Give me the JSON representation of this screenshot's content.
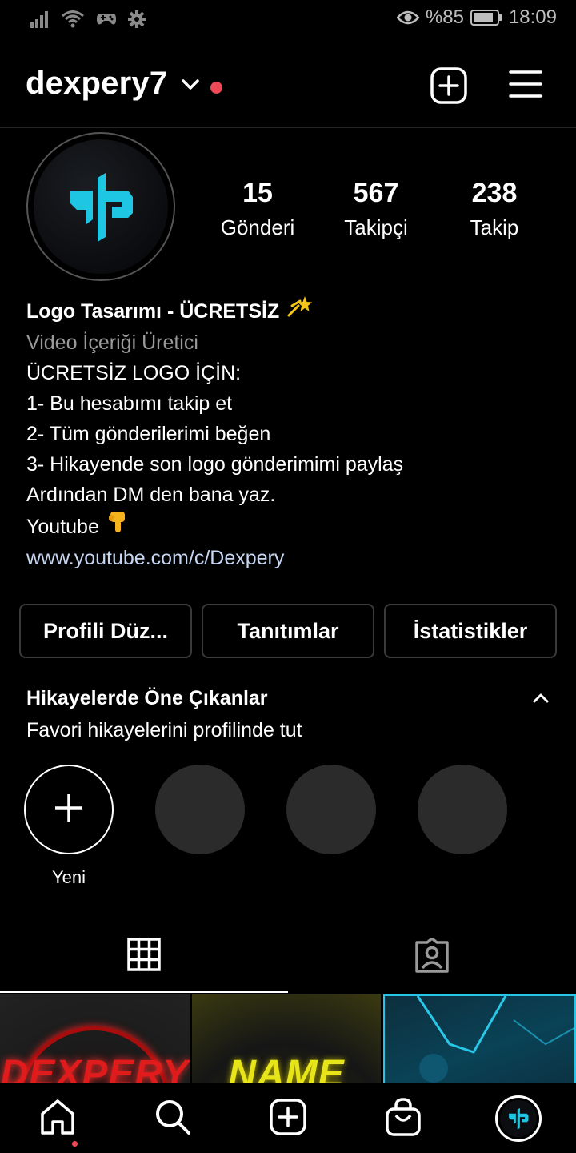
{
  "status_bar": {
    "battery": "%85",
    "time": "18:09",
    "icons": [
      "signal-icon",
      "wifi-icon",
      "game-controller-icon",
      "gear-icon",
      "eye-icon",
      "battery-icon"
    ]
  },
  "header": {
    "username": "dexpery7",
    "icons": [
      "chevron-down-icon",
      "notification-dot",
      "new-post-icon",
      "menu-icon"
    ]
  },
  "profile": {
    "stats": [
      {
        "value": "15",
        "label": "Gönderi"
      },
      {
        "value": "567",
        "label": "Takipçi"
      },
      {
        "value": "238",
        "label": "Takip"
      }
    ]
  },
  "bio": {
    "name": "Logo Tasarımı - ÜCRETSİZ",
    "category": "Video İçeriği Üretici",
    "lines": [
      "ÜCRETSİZ LOGO İÇİN:",
      "1- Bu hesabımı takip et",
      "2- Tüm gönderilerimi beğen",
      "3- Hikayende son logo gönderimimi paylaş",
      "Ardından DM den bana yaz."
    ],
    "youtube_label": "Youtube",
    "link": "www.youtube.com/c/Dexpery"
  },
  "buttons": {
    "edit_profile": "Profili Düz...",
    "promotions": "Tanıtımlar",
    "insights": "İstatistikler"
  },
  "highlights": {
    "title": "Hikayelerde Öne Çıkanlar",
    "subtitle": "Favori hikayelerini profilinde tut",
    "new_label": "Yeni"
  },
  "posts": [
    {
      "text": "DEXPERY"
    },
    {
      "text": "NAME"
    },
    {
      "text": ""
    }
  ],
  "colors": {
    "background": "#000000",
    "accent_cyan": "#1fc6e3",
    "notification_red": "#ed4956",
    "muted_text": "#9a9a9a",
    "link_text": "#c7d7f3",
    "button_border": "#3a3a3a"
  }
}
